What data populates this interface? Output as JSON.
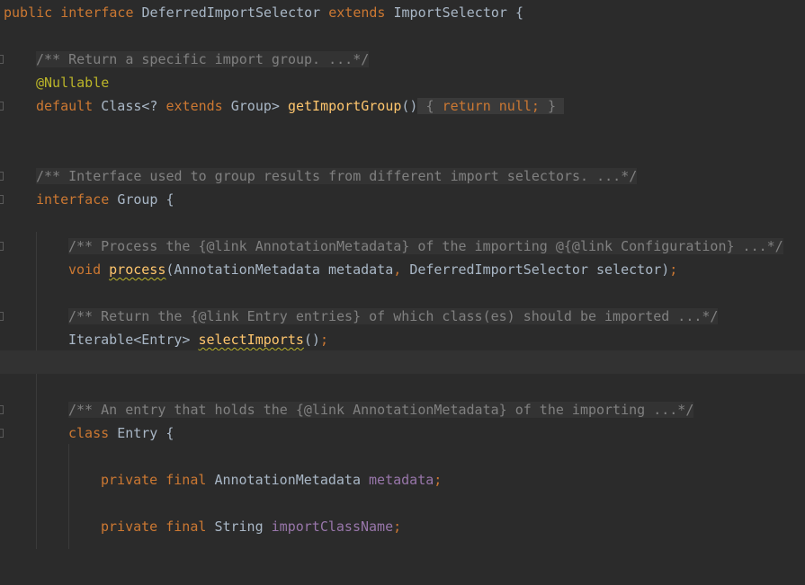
{
  "editor": {
    "lines": {
      "decl": {
        "kw_public": "public",
        "kw_interface": "interface",
        "name": "DeferredImportSelector",
        "kw_extends": "extends",
        "parent": "ImportSelector",
        "brace": "{"
      },
      "doc_import_group": "/** Return a specific import group. ...*/",
      "annotation": "@Nullable",
      "method_get_import_group": {
        "kw_default": "default",
        "type_class": "Class<?",
        "kw_extends": "extends",
        "type_group": "Group>",
        "name": "getImportGroup",
        "parens": "()",
        "fold_open": "{",
        "kw_return": "return",
        "kw_null": "null",
        "semicolon": ";",
        "fold_close": "}"
      },
      "doc_group": "/** Interface used to group results from different import selectors. ...*/",
      "group_decl": {
        "kw_interface": "interface",
        "name": "Group",
        "brace": "{"
      },
      "doc_process": "/** Process the {@link AnnotationMetadata} of the importing @{@link Configuration} ...*/",
      "method_process": {
        "kw_void": "void",
        "name": "process",
        "params_a": "(AnnotationMetadata metadata",
        "comma": ",",
        "params_b": "DeferredImportSelector selector)",
        "semicolon": ";"
      },
      "doc_select_imports": "/** Return the {@link Entry entries} of which class(es) should be imported ...*/",
      "method_select_imports": {
        "type": "Iterable<Entry>",
        "name": "selectImports",
        "parens": "()",
        "semicolon": ";"
      },
      "doc_entry": "/** An entry that holds the {@link AnnotationMetadata} of the importing ...*/",
      "entry_decl": {
        "kw_class": "class",
        "name": "Entry",
        "brace": "{"
      },
      "field_metadata": {
        "kw_private": "private",
        "kw_final": "final",
        "type": "AnnotationMetadata",
        "name": "metadata",
        "semicolon": ";"
      },
      "field_import_class_name": {
        "kw_private": "private",
        "kw_final": "final",
        "type": "String",
        "name": "importClassName",
        "semicolon": ";"
      }
    }
  },
  "colors": {
    "background": "#2b2b2b",
    "current_line": "#323232",
    "keyword": "#cc7832",
    "annotation": "#bbb529",
    "method": "#ffc66d",
    "field": "#9876aa",
    "comment": "#808080",
    "text": "#a9b7c6"
  }
}
